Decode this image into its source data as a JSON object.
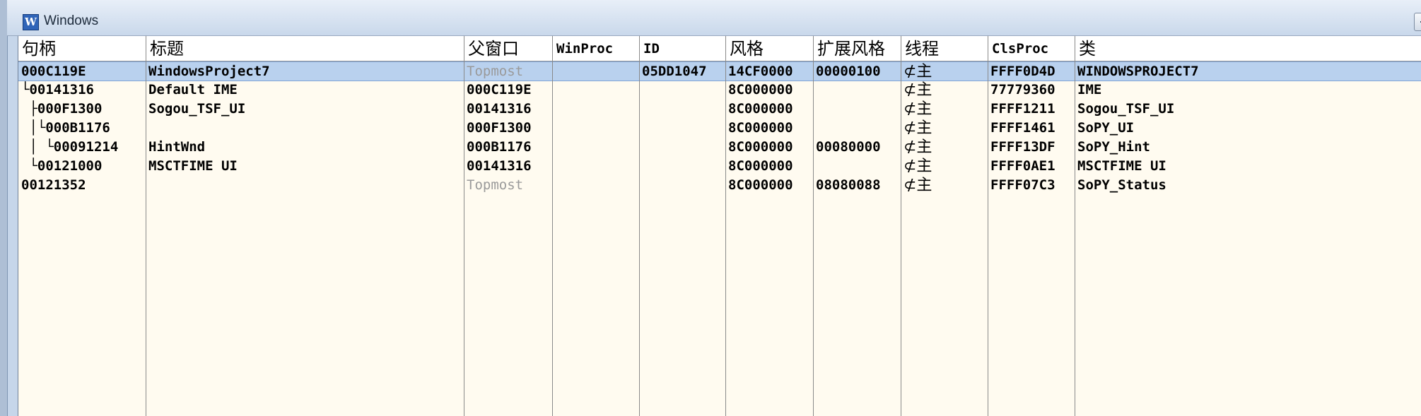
{
  "window": {
    "title": "Windows",
    "icon": "w-app-icon",
    "icon_letter": "W"
  },
  "columns": [
    "句柄",
    "标题",
    "父窗口",
    "WinProc",
    "ID",
    "风格",
    "扩展风格",
    "线程",
    "ClsProc",
    "类"
  ],
  "rows": [
    {
      "handle": "000C119E",
      "title": "WindowsProject7",
      "parent": "Topmost",
      "winproc": "",
      "id": "05DD1047",
      "style": "14CF0000",
      "exstyle": "00000100",
      "thread": "⊄主",
      "clsproc": "FFFF0D4D",
      "cls": "WINDOWSPROJECT7"
    },
    {
      "handle": "└00141316",
      "title": "Default IME",
      "parent": "000C119E",
      "winproc": "",
      "id": "",
      "style": "8C000000",
      "exstyle": "",
      "thread": "⊄主",
      "clsproc": "77779360",
      "cls": "IME"
    },
    {
      "handle": " ├000F1300",
      "title": "Sogou_TSF_UI",
      "parent": "00141316",
      "winproc": "",
      "id": "",
      "style": "8C000000",
      "exstyle": "",
      "thread": "⊄主",
      "clsproc": "FFFF1211",
      "cls": "Sogou_TSF_UI"
    },
    {
      "handle": " │└000B1176",
      "title": "",
      "parent": "000F1300",
      "winproc": "",
      "id": "",
      "style": "8C000000",
      "exstyle": "",
      "thread": "⊄主",
      "clsproc": "FFFF1461",
      "cls": "SoPY_UI"
    },
    {
      "handle": " │ └00091214",
      "title": "HintWnd",
      "parent": "000B1176",
      "winproc": "",
      "id": "",
      "style": "8C000000",
      "exstyle": "00080000",
      "thread": "⊄主",
      "clsproc": "FFFF13DF",
      "cls": "SoPY_Hint"
    },
    {
      "handle": " └00121000",
      "title": "MSCTFIME UI",
      "parent": "00141316",
      "winproc": "",
      "id": "",
      "style": "8C000000",
      "exstyle": "",
      "thread": "⊄主",
      "clsproc": "FFFF0AE1",
      "cls": "MSCTFIME UI"
    },
    {
      "handle": "00121352",
      "title": "",
      "parent": "Topmost",
      "winproc": "",
      "id": "",
      "style": "8C000000",
      "exstyle": "08080088",
      "thread": "⊄主",
      "clsproc": "FFFF07C3",
      "cls": "SoPY_Status"
    }
  ],
  "selected_row": 0,
  "colors": {
    "selected": "#b9d1ee",
    "background": "#fffbf0",
    "muted_text": "#9a9a9a"
  }
}
